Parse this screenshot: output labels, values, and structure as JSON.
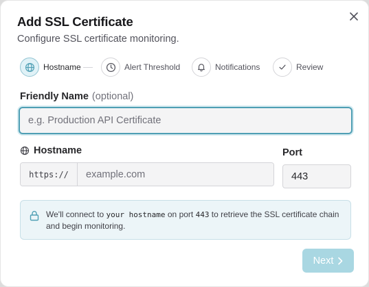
{
  "dialog": {
    "title": "Add SSL Certificate",
    "subtitle": "Configure SSL certificate monitoring.",
    "close_icon": "close-icon"
  },
  "stepper": {
    "steps": [
      {
        "label": "Hostname",
        "icon": "globe-icon",
        "active": true
      },
      {
        "label": "Alert Threshold",
        "icon": "clock-icon",
        "active": false
      },
      {
        "label": "Notifications",
        "icon": "bell-icon",
        "active": false
      },
      {
        "label": "Review",
        "icon": "check-icon",
        "active": false
      }
    ]
  },
  "friendly_name": {
    "label": "Friendly Name",
    "optional": "(optional)",
    "value": "",
    "placeholder": "e.g. Production API Certificate"
  },
  "hostname": {
    "label": "Hostname",
    "icon": "globe-icon",
    "prefix": "https://",
    "value": "",
    "placeholder": "example.com"
  },
  "port": {
    "label": "Port",
    "value": "443"
  },
  "info": {
    "icon": "lock-icon",
    "text_before": "We'll connect to ",
    "hostname_code": "your hostname",
    "text_middle": " on port ",
    "port_code": "443",
    "text_after": " to retrieve the SSL certificate chain and begin monitoring."
  },
  "footer": {
    "next_label": "Next",
    "next_icon": "chevron-right-icon",
    "next_disabled": true
  },
  "colors": {
    "accent": "#4f9fb4",
    "accent_light": "#e0f2f7",
    "button_disabled": "#a9d7e2",
    "info_bg": "#ecf5f8"
  }
}
